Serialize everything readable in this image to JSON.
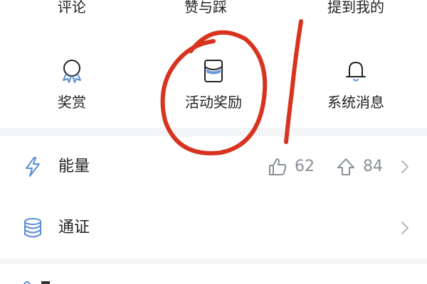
{
  "top_tabs": [
    {
      "label": "评论"
    },
    {
      "label": "赞与踩"
    },
    {
      "label": "提到我的"
    }
  ],
  "features": [
    {
      "label": "奖赏",
      "icon": "medal-icon"
    },
    {
      "label": "活动奖励",
      "icon": "gift-envelope-icon"
    },
    {
      "label": "系统消息",
      "icon": "bell-icon"
    }
  ],
  "rows": [
    {
      "label": "能量",
      "icon": "lightning-icon",
      "likes": "62",
      "upvotes": "84"
    },
    {
      "label": "通证",
      "icon": "database-icon"
    }
  ],
  "colors": {
    "accent_blue": "#5b8ed6",
    "icon_gray": "#8a8f99",
    "annotation_red": "#d8331f",
    "divider": "#f4f5f7"
  }
}
